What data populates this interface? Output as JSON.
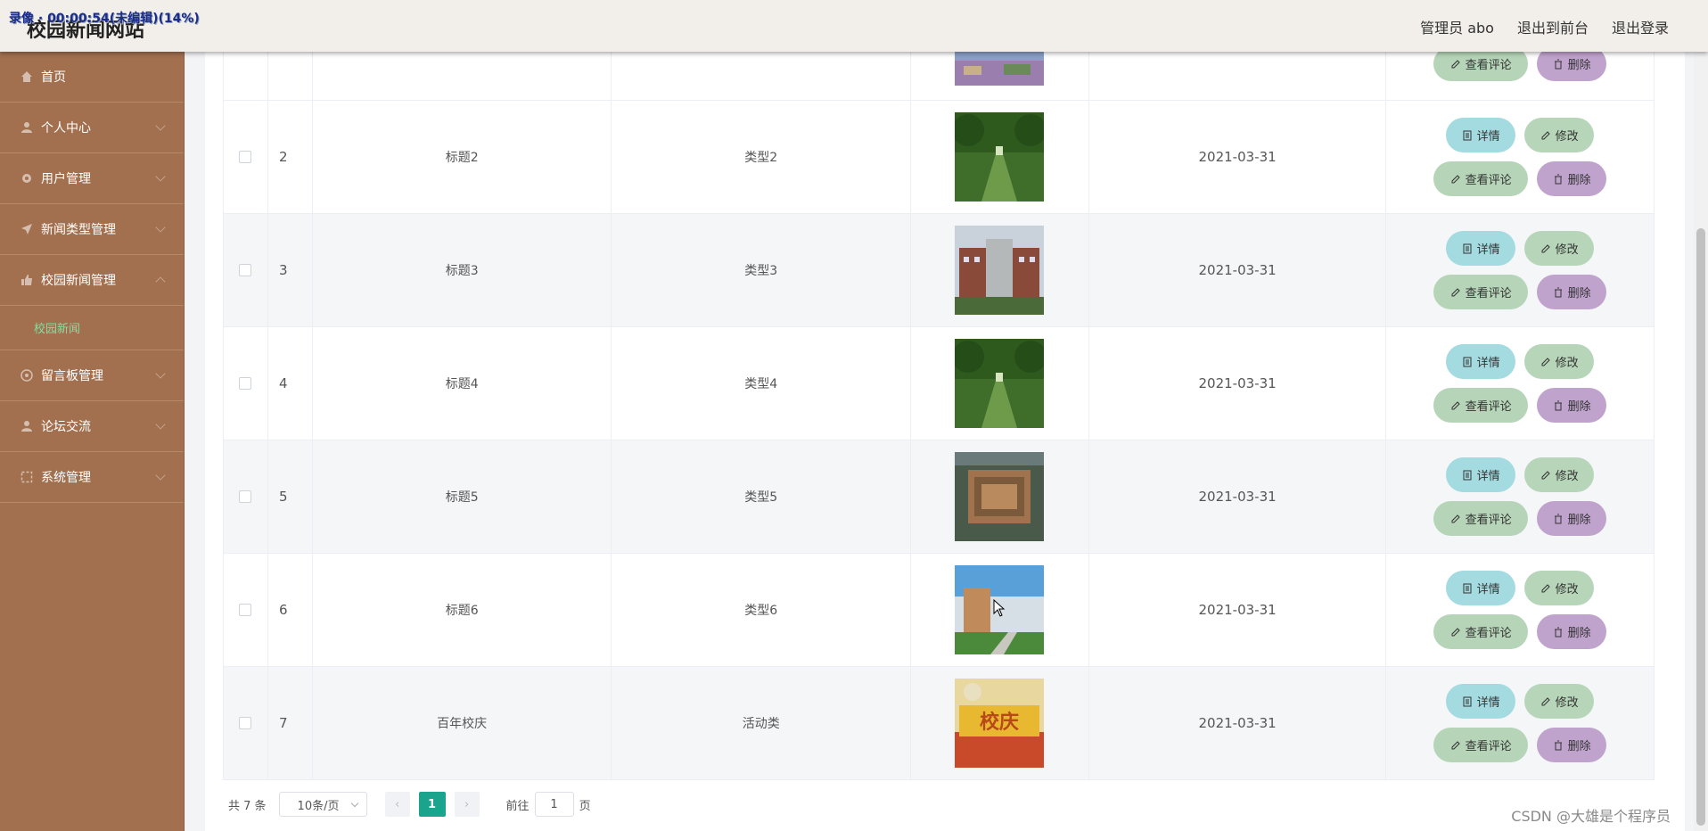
{
  "recording_label": "录像 · 00:00:54(未编辑)(14%)",
  "site_title": "校园新闻网站",
  "top_links": [
    "管理员 abo",
    "退出到前台",
    "退出登录"
  ],
  "sidebar": {
    "items": [
      {
        "label": "首页",
        "icon": "home-icon"
      },
      {
        "label": "个人中心",
        "icon": "person-icon"
      },
      {
        "label": "用户管理",
        "icon": "gear-icon"
      },
      {
        "label": "新闻类型管理",
        "icon": "send-icon"
      },
      {
        "label": "校园新闻管理",
        "icon": "thumbs-up-icon",
        "submenu": "校园新闻"
      },
      {
        "label": "留言板管理",
        "icon": "circle-icon"
      },
      {
        "label": "论坛交流",
        "icon": "person-icon"
      },
      {
        "label": "系统管理",
        "icon": "frame-icon"
      }
    ]
  },
  "rows": [
    {
      "index": "2",
      "title": "标题2",
      "type": "类型2",
      "date": "2021-03-31",
      "image": "campus-avenue-photo"
    },
    {
      "index": "3",
      "title": "标题3",
      "type": "类型3",
      "date": "2021-03-31",
      "image": "campus-building-photo"
    },
    {
      "index": "4",
      "title": "标题4",
      "type": "类型4",
      "date": "2021-03-31",
      "image": "campus-avenue-photo"
    },
    {
      "index": "5",
      "title": "标题5",
      "type": "类型5",
      "date": "2021-03-31",
      "image": "campus-aerial-photo"
    },
    {
      "index": "6",
      "title": "标题6",
      "type": "类型6",
      "date": "2021-03-31",
      "image": "campus-sky-photo"
    },
    {
      "index": "7",
      "title": "百年校庆",
      "type": "活动类",
      "date": "2021-03-31",
      "image": "anniversary-photo"
    }
  ],
  "actions": {
    "detail": "详情",
    "edit": "修改",
    "comments": "查看评论",
    "delete": "删除"
  },
  "pagination": {
    "total": "共 7 条",
    "page_size": "10条/页",
    "current": "1",
    "goto_prefix": "前往",
    "goto_value": "1",
    "goto_suffix": "页"
  },
  "watermark": "CSDN @大雄是个程序员",
  "colors": {
    "sidebar": "#a2704f",
    "active_page": "#1aa38d",
    "submenu_active": "#7fe0a0"
  }
}
